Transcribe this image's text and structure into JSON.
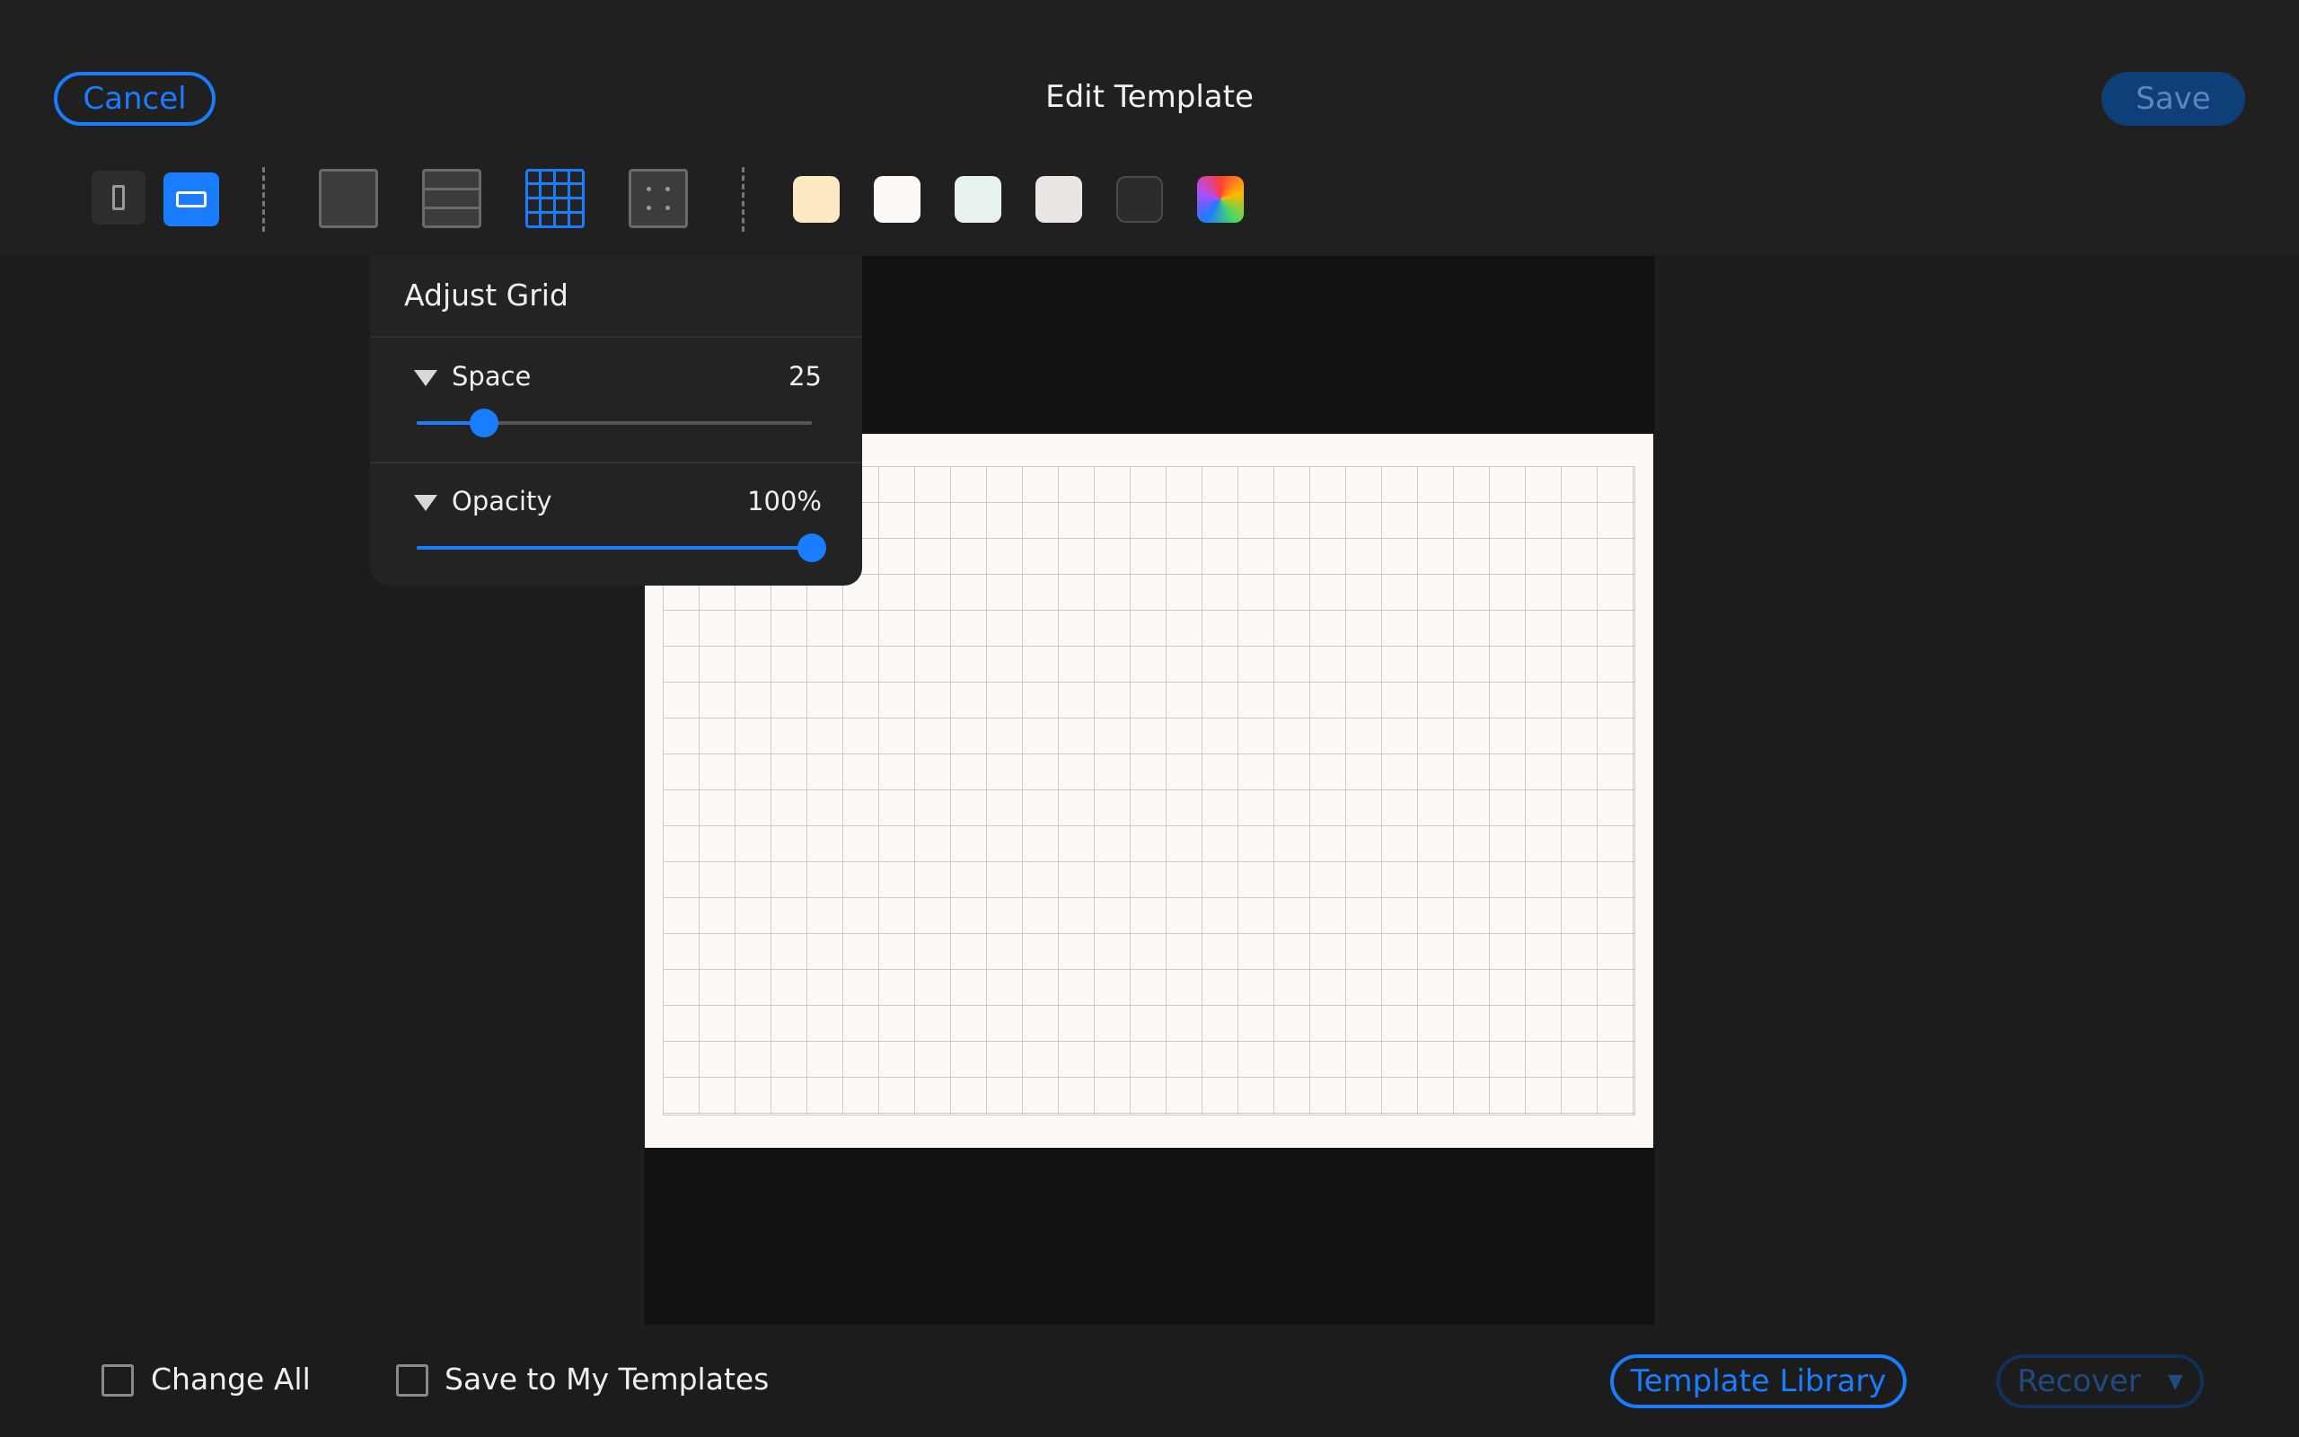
{
  "header": {
    "title": "Edit Template",
    "cancel_label": "Cancel",
    "save_label": "Save"
  },
  "toolbar": {
    "orientation": {
      "portrait_icon": "portrait-orientation-icon",
      "landscape_icon": "landscape-orientation-icon",
      "selected": "landscape"
    },
    "templates": [
      "blank",
      "lined",
      "grid",
      "dot"
    ],
    "selected_template": "grid",
    "paper_colors": [
      "#fde9c2",
      "#fcf9f6",
      "#e7f1ef",
      "#ebe6e3",
      "#2c2c2c",
      "rainbow"
    ]
  },
  "adjust_grid": {
    "title": "Adjust Grid",
    "space": {
      "label": "Space",
      "value": "25",
      "fraction": 0.17
    },
    "opacity": {
      "label": "Opacity",
      "value": "100%",
      "fraction": 1.0
    }
  },
  "footer": {
    "change_all_label": "Change All",
    "save_to_my_templates_label": "Save to My Templates",
    "template_library_label": "Template Library",
    "recover_label": "Recover",
    "recover_arrow": "▼"
  },
  "colors": {
    "accent": "#1a7cff",
    "background": "#1c1c1c",
    "toolbar": "#202020"
  }
}
